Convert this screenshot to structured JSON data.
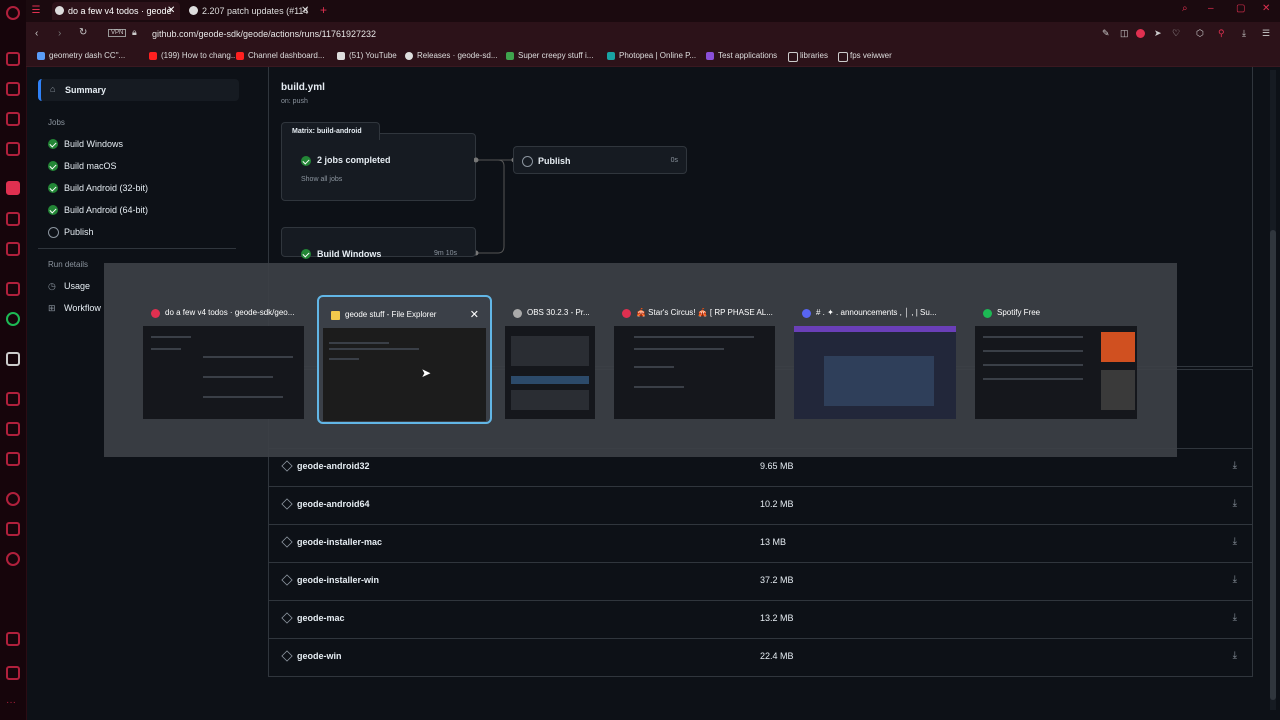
{
  "browser": {
    "tabs": [
      {
        "label": "do a few v4 todos · geode"
      },
      {
        "label": "2.207 patch updates (#114"
      }
    ],
    "new_tab_symbol": "+",
    "vpn_badge": "VPN",
    "url": "github.com/geode-sdk/geode/actions/runs/11761927232",
    "bookmarks": [
      {
        "label": "geometry dash CC\"...",
        "color": "#5a9cf8"
      },
      {
        "label": "(199) How to chang...",
        "color": "#ff2020"
      },
      {
        "label": "Channel dashboard...",
        "color": "#ff2020"
      },
      {
        "label": "(51) YouTube",
        "color": "#dddddd"
      },
      {
        "label": "Releases · geode-sd...",
        "color": "#dddddd"
      },
      {
        "label": "Super creepy stuff i...",
        "color": "#3fa34d"
      },
      {
        "label": "Photopea | Online P...",
        "color": "#19a3a3"
      },
      {
        "label": "Test applications",
        "color": "#8a4fd8"
      },
      {
        "label": "libraries",
        "color": "#cccccc"
      },
      {
        "label": "fps veiwwer",
        "color": "#cccccc"
      }
    ]
  },
  "sidebar": {
    "summary": "Summary",
    "jobs_heading": "Jobs",
    "jobs": [
      {
        "label": "Build Windows",
        "status": "success"
      },
      {
        "label": "Build macOS",
        "status": "success"
      },
      {
        "label": "Build Android (32-bit)",
        "status": "success"
      },
      {
        "label": "Build Android (64-bit)",
        "status": "success"
      },
      {
        "label": "Publish",
        "status": "skipped"
      }
    ],
    "run_details_heading": "Run details",
    "usage": "Usage",
    "workflow": "Workflow"
  },
  "workflow": {
    "file": "build.yml",
    "trigger": "on: push",
    "matrix_label": "Matrix: build-android",
    "matrix_status": "2 jobs completed",
    "show_all": "Show all jobs",
    "publish_label": "Publish",
    "publish_time": "0s",
    "windows_label": "Build Windows",
    "windows_time": "9m 10s"
  },
  "artifacts": [
    {
      "name": "geode-android32",
      "size": "9.65 MB"
    },
    {
      "name": "geode-android64",
      "size": "10.2 MB"
    },
    {
      "name": "geode-installer-mac",
      "size": "13 MB"
    },
    {
      "name": "geode-installer-win",
      "size": "37.2 MB"
    },
    {
      "name": "geode-mac",
      "size": "13.2 MB"
    },
    {
      "name": "geode-win",
      "size": "22.4 MB"
    }
  ],
  "switcher": {
    "windows": [
      {
        "title": "do a few v4 todos · geode-sdk/geo...",
        "icon_color": "#e03050"
      },
      {
        "title": "geode stuff - File Explorer",
        "icon_color": "#f2c94c",
        "selected": true
      },
      {
        "title": "OBS 30.2.3 - Pr...",
        "icon_color": "#aaaaaa"
      },
      {
        "title": "🎪 Star's Circus! 🎪 [ RP PHASE AL...",
        "icon_color": "#e03050"
      },
      {
        "title": "# . ✦ . announcements , │ , | Su...",
        "icon_color": "#5865f2"
      },
      {
        "title": "Spotify Free",
        "icon_color": "#1db954"
      }
    ],
    "close_symbol": "✕"
  }
}
